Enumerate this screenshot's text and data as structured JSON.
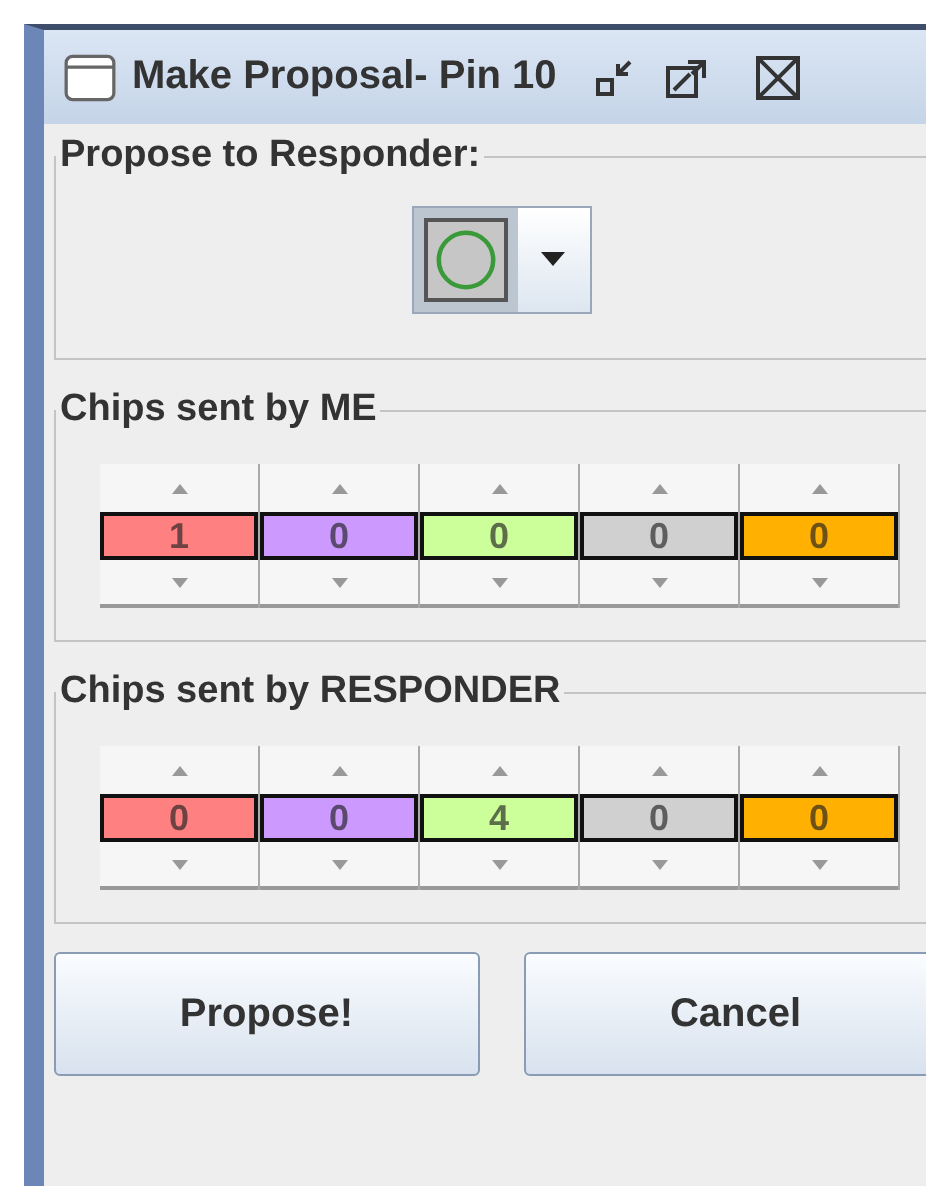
{
  "window": {
    "title": "Make Proposal- Pin 10"
  },
  "responder_section": {
    "title": "Propose to Responder:"
  },
  "chip_sections": [
    {
      "title": "Chips sent by ME",
      "chips": [
        {
          "value": "1",
          "color": "#ff8080"
        },
        {
          "value": "0",
          "color": "#cc99ff"
        },
        {
          "value": "0",
          "color": "#ccff99"
        },
        {
          "value": "0",
          "color": "#d0d0d0"
        },
        {
          "value": "0",
          "color": "#ffb000"
        }
      ]
    },
    {
      "title": "Chips sent by RESPONDER",
      "chips": [
        {
          "value": "0",
          "color": "#ff8080"
        },
        {
          "value": "0",
          "color": "#cc99ff"
        },
        {
          "value": "4",
          "color": "#ccff99"
        },
        {
          "value": "0",
          "color": "#d0d0d0"
        },
        {
          "value": "0",
          "color": "#ffb000"
        }
      ]
    }
  ],
  "buttons": [
    "Propose!",
    "Cancel"
  ]
}
